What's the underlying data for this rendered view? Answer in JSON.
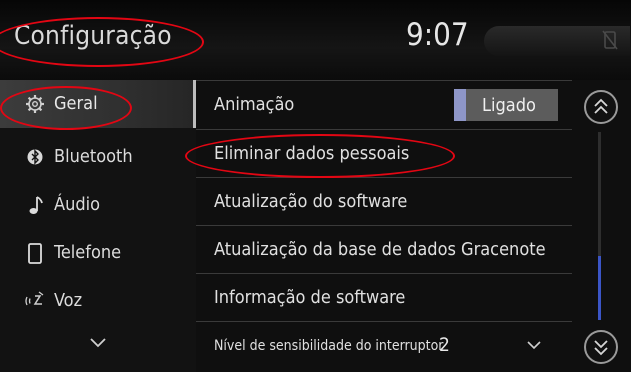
{
  "header": {
    "title": "Configuração",
    "clock": "9:07",
    "status_icon": "no-phone-icon"
  },
  "sidebar": {
    "items": [
      {
        "label": "Geral",
        "icon": "gear-icon",
        "selected": true
      },
      {
        "label": "Bluetooth",
        "icon": "bluetooth-icon",
        "selected": false
      },
      {
        "label": "Áudio",
        "icon": "music-note-icon",
        "selected": false
      },
      {
        "label": "Telefone",
        "icon": "phone-icon",
        "selected": false
      },
      {
        "label": "Voz",
        "icon": "voice-icon",
        "selected": false
      }
    ],
    "more_icon": "chevron-down-icon"
  },
  "main": {
    "rows": [
      {
        "label": "Animação",
        "toggle_label": "Ligado"
      },
      {
        "label": "Eliminar dados pessoais"
      },
      {
        "label": "Atualização do software"
      },
      {
        "label": "Atualização da base de dados Gracenote"
      },
      {
        "label": "Informação de software"
      },
      {
        "label": "Nível de sensibilidade do interruptor",
        "value": "2"
      }
    ]
  },
  "scroll": {
    "up_icon": "double-chevron-up-icon",
    "down_icon": "double-chevron-down-icon",
    "position": 0.66
  },
  "colors": {
    "annotation": "#e30613",
    "accent": "#3b55c7",
    "toggle_on": "#8e96c8"
  }
}
